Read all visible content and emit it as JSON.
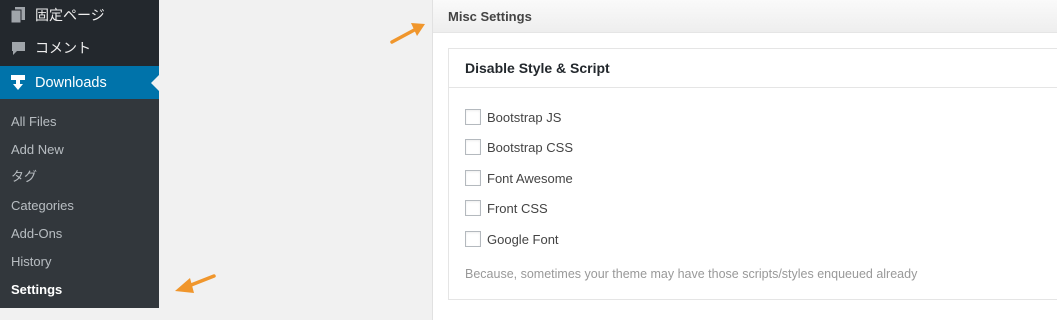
{
  "sidebar": {
    "menu": [
      {
        "label": "固定ページ",
        "icon": "pages-icon"
      },
      {
        "label": "コメント",
        "icon": "comments-icon"
      }
    ],
    "active": {
      "label": "Downloads",
      "icon": "download-icon"
    },
    "submenu": [
      "All Files",
      "Add New",
      "タグ",
      "Categories",
      "Add-Ons",
      "History",
      "Settings"
    ],
    "current_submenu": "Settings"
  },
  "panel": {
    "title": "Misc Settings",
    "card": {
      "title": "Disable Style & Script",
      "options": [
        {
          "label": "Bootstrap JS",
          "checked": false
        },
        {
          "label": "Bootstrap CSS",
          "checked": false
        },
        {
          "label": "Font Awesome",
          "checked": false
        },
        {
          "label": "Front CSS",
          "checked": false
        },
        {
          "label": "Google Font",
          "checked": false
        }
      ],
      "note": "Because, sometimes your theme may have those scripts/styles enqueued already"
    }
  },
  "colors": {
    "sidebar_bg": "#23282d",
    "submenu_bg": "#32373c",
    "accent": "#0073aa",
    "arrow": "#f0962c"
  }
}
